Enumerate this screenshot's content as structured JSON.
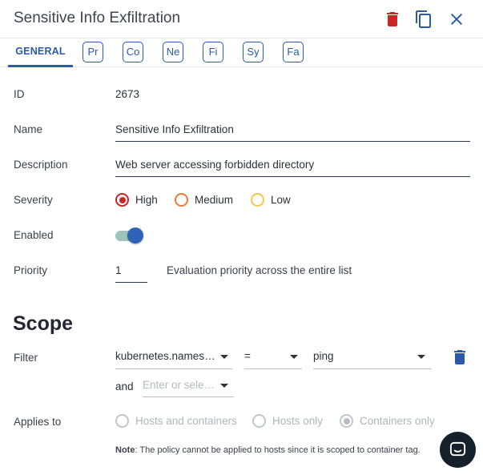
{
  "header": {
    "title": "Sensitive Info Exfiltration",
    "icons": [
      "trash-icon",
      "copy-icon",
      "close-icon"
    ],
    "delete_color": "#c62828",
    "accent_color": "#2a5aa8"
  },
  "tabs": {
    "active": "GENERAL",
    "chips": [
      "Pr",
      "Co",
      "Ne",
      "Fi",
      "Sy",
      "Fa"
    ]
  },
  "form": {
    "id": {
      "label": "ID",
      "value": "2673"
    },
    "name": {
      "label": "Name",
      "value": "Sensitive Info Exfiltration"
    },
    "description": {
      "label": "Description",
      "value": "Web server accessing forbidden directory"
    },
    "severity": {
      "label": "Severity",
      "options": [
        {
          "label": "High",
          "color": "#c62828",
          "selected": true
        },
        {
          "label": "Medium",
          "color": "#e67e3a",
          "selected": false
        },
        {
          "label": "Low",
          "color": "#f2c94c",
          "selected": false
        }
      ]
    },
    "enabled": {
      "label": "Enabled",
      "value": true
    },
    "priority": {
      "label": "Priority",
      "value": "1",
      "hint": "Evaluation priority across the entire list"
    }
  },
  "scope": {
    "title": "Scope",
    "filter": {
      "label": "Filter",
      "key": "kubernetes.names…",
      "operator": "=",
      "value": "ping",
      "and_label": "and",
      "and_placeholder": "Enter or sele…"
    },
    "applies_to": {
      "label": "Applies to",
      "options": [
        {
          "label": "Hosts and containers",
          "selected": false
        },
        {
          "label": "Hosts only",
          "selected": false
        },
        {
          "label": "Containers only",
          "selected": true
        }
      ]
    },
    "note": {
      "prefix": "Note",
      "text": ": The policy cannot be applied to hosts since it is scoped to container tag."
    }
  }
}
